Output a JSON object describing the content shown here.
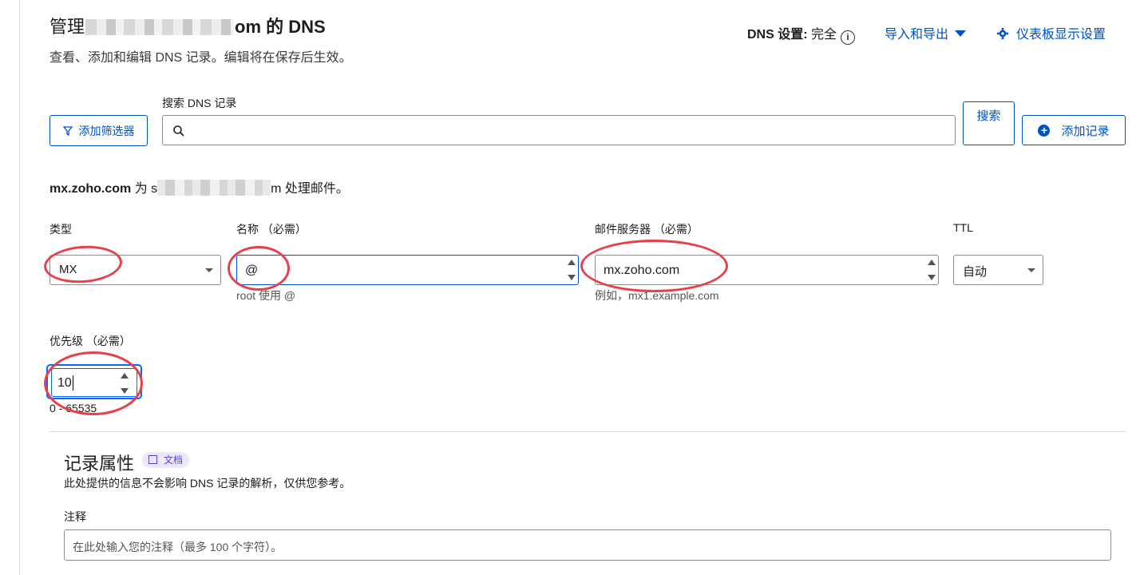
{
  "header": {
    "title_prefix": "管理",
    "title_suffix": "om 的 DNS",
    "subtitle": "查看、添加和编辑 DNS 记录。编辑将在保存后生效。",
    "dns_setting_label": "DNS 设置:",
    "dns_setting_value": "完全",
    "import_export": "导入和导出",
    "dashboard_settings": "仪表板显示设置"
  },
  "search": {
    "filter_button": "添加筛选器",
    "label": "搜索 DNS 记录",
    "placeholder": "",
    "search_button": "搜索",
    "add_record_button": "添加记录"
  },
  "mail_note": {
    "server": "mx.zoho.com",
    "prefix": "为 s",
    "suffix": "m 处理邮件。"
  },
  "form": {
    "type": {
      "label": "类型",
      "value": "MX"
    },
    "name": {
      "label": "名称 （必需）",
      "value": "@",
      "hint": "root 使用 @"
    },
    "mail_server": {
      "label": "邮件服务器 （必需）",
      "value": "mx.zoho.com",
      "hint": "例如，mx1.example.com"
    },
    "ttl": {
      "label": "TTL",
      "value": "自动"
    },
    "priority": {
      "label": "优先级 （必需）",
      "value": "10",
      "hint": "0 - 65535"
    }
  },
  "record_attributes": {
    "title": "记录属性",
    "doc_badge": "文档",
    "description": "此处提供的信息不会影响 DNS 记录的解析，仅供您参考。",
    "comment_label": "注释",
    "comment_placeholder": "在此处输入您的注释（最多 100 个字符）。"
  },
  "colors": {
    "accent": "#0051c3",
    "annotation_ring": "#e8404b",
    "focus": "#0a66ff"
  }
}
